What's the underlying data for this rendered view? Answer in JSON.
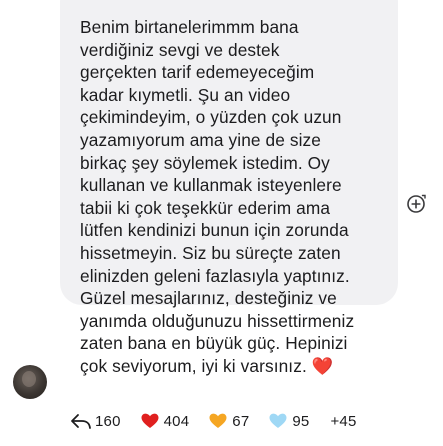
{
  "message": {
    "text": "Benim birtanelerimmm bana\nverdiğiniz sevgi ve destek\ngerçekten tarif edemeyeceğim\nkadar kıymetli. Şu an video\nçekimindeyim, o yüzden çok uzun\nyazamıyorum ama yine de size\nbirkaç şey söylemek istedim. Oy\nkullanan ve kullanmak isteyenlere\ntabii ki çok teşekkür ederim ama\nlütfen kendinizi bunun için zorunda\nhissetmeyin. Siz bu süreçte zaten\nelinizden geleni fazlasıyla yaptınız.\nGüzel mesajlarınız, desteğiniz ve\nyanımda olduğunuzu hissettirmeniz\nzaten bana en büyük güç. Hepinizi\nçok seviyorum, iyi ki varsınız. ❤️"
  },
  "reactions": {
    "reply_count": "160",
    "red_heart_count": "404",
    "orange_heart_count": "67",
    "blue_heart_count": "95",
    "more_label": "+45"
  },
  "colors": {
    "bubble": "#f1f1f3",
    "text": "#1c1c1e",
    "red_heart": "#e0201f",
    "orange_heart": "#f5a623",
    "blue_heart": "#9fd8f5"
  },
  "icons": {
    "add_reaction": "add-reaction-icon",
    "reply": "reply-arrow-icon",
    "avatar": "avatar"
  }
}
